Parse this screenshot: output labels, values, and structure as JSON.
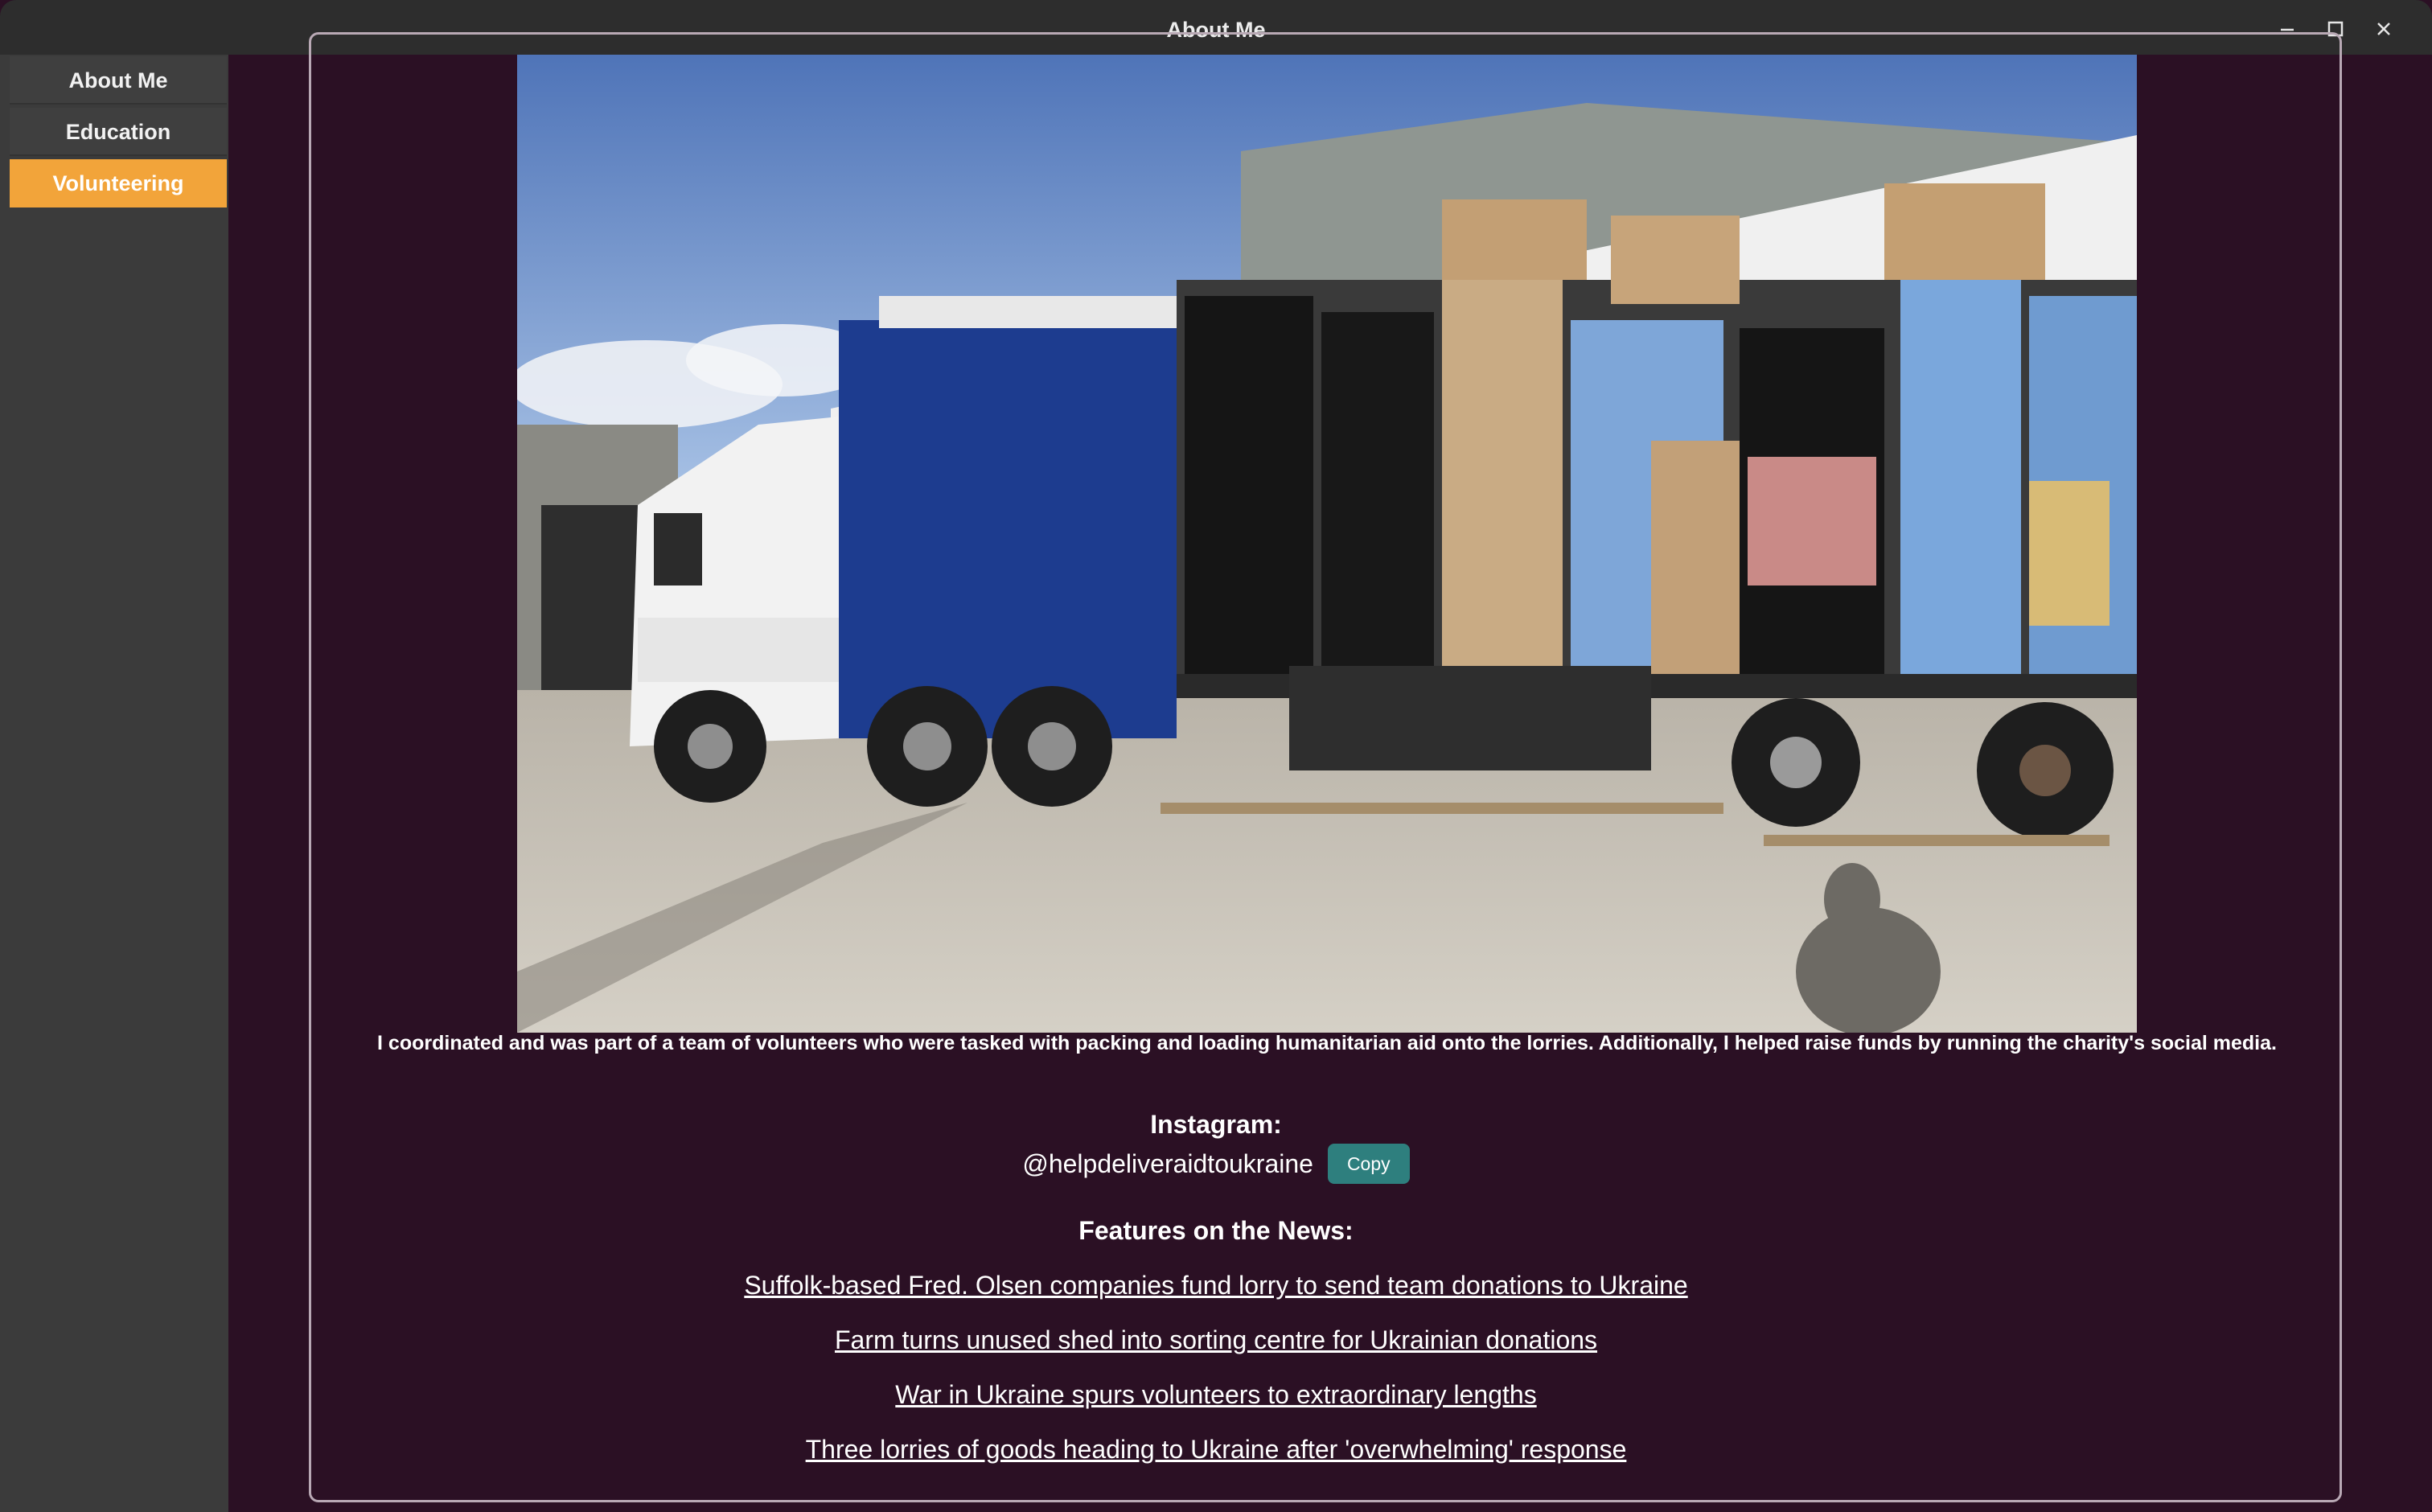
{
  "window": {
    "title": "About Me"
  },
  "sidebar": {
    "items": [
      {
        "label": "About Me"
      },
      {
        "label": "Education"
      },
      {
        "label": "Volunteering"
      }
    ]
  },
  "main": {
    "description": "I coordinated and was part of a team of volunteers who were tasked with packing and loading humanitarian aid onto the lorries. Additionally, I helped raise funds by running the charity's social media.",
    "instagram_heading": "Instagram:",
    "instagram_handle": "@helpdeliveraidtoukraine",
    "copy_label": "Copy",
    "news_heading": "Features on the News:",
    "news_links": [
      "Suffolk-based Fred. Olsen companies fund lorry to send team donations to Ukraine",
      "Farm turns unused shed into sorting centre for Ukrainian donations",
      "War in Ukraine spurs volunteers to extraordinary lengths",
      "Three lorries of goods heading to Ukraine after 'overwhelming' response"
    ]
  },
  "colors": {
    "accent": "#f2a43a",
    "background": "#2b1024",
    "copy_button": "#2e7f7e",
    "sidebar": "#3b3b3b"
  },
  "icons": {
    "minimize": "minimize-icon",
    "maximize": "maximize-icon",
    "close": "close-icon"
  }
}
